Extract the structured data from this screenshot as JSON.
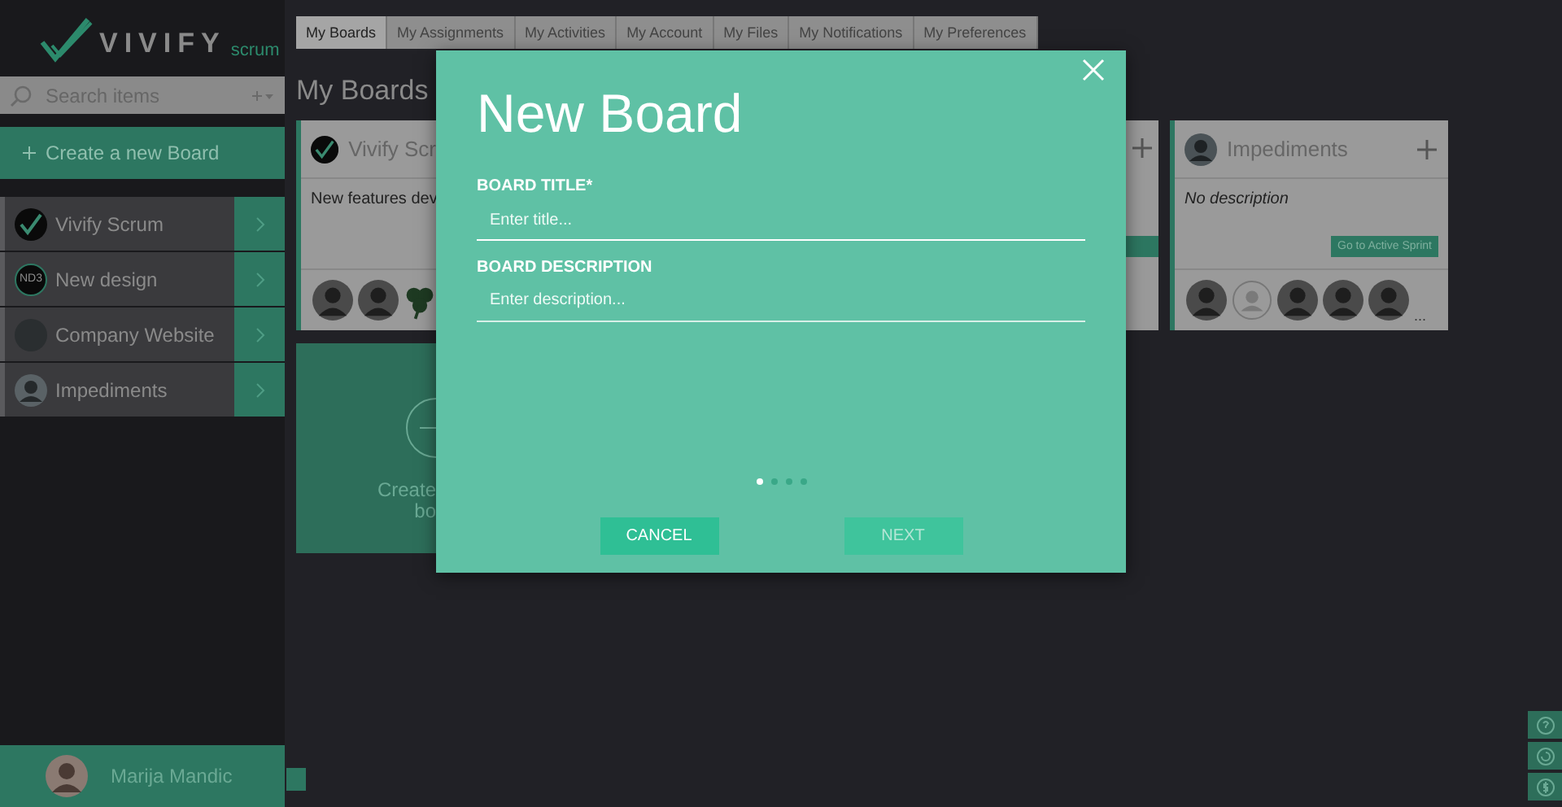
{
  "sidebar": {
    "logo": {
      "wordmark": "VIVIFY",
      "suffix": "scrum"
    },
    "search": {
      "placeholder": "Search items"
    },
    "create_button": "Create a new Board",
    "boards": [
      {
        "name": "Vivify Scrum",
        "kind": "logo"
      },
      {
        "name": "New design",
        "kind": "initials",
        "initials": "ND3"
      },
      {
        "name": "Company Website",
        "kind": "blank"
      },
      {
        "name": "Impediments",
        "kind": "person"
      }
    ],
    "user": {
      "name": "Marija Mandic"
    }
  },
  "tabs": [
    {
      "label": "My Boards",
      "selected": true
    },
    {
      "label": "My Assignments",
      "selected": false
    },
    {
      "label": "My Activities",
      "selected": false
    },
    {
      "label": "My Account",
      "selected": false
    },
    {
      "label": "My Files",
      "selected": false
    },
    {
      "label": "My Notifications",
      "selected": false
    },
    {
      "label": "My Preferences",
      "selected": false
    }
  ],
  "page_title": "My Boards",
  "cards": [
    {
      "title": "Vivify Scr",
      "description": "New features dev"
    },
    {
      "title": "Impediments",
      "description": "No description",
      "button": "Go to Active Sprint",
      "more": "..."
    }
  ],
  "create_card": {
    "lines": [
      "Create",
      "bo"
    ]
  },
  "modal": {
    "title": "New Board",
    "fields": [
      {
        "label": "BOARD TITLE*",
        "placeholder": "Enter title...",
        "kind": "input"
      },
      {
        "label": "BOARD DESCRIPTION",
        "placeholder": "Enter description...",
        "kind": "textarea"
      }
    ],
    "steps": [
      {
        "selected": true
      },
      {
        "selected": false
      },
      {
        "selected": false
      },
      {
        "selected": false
      }
    ],
    "buttons": [
      {
        "label": "CANCEL",
        "disabled": false
      },
      {
        "label": "NEXT",
        "disabled": true
      }
    ]
  }
}
